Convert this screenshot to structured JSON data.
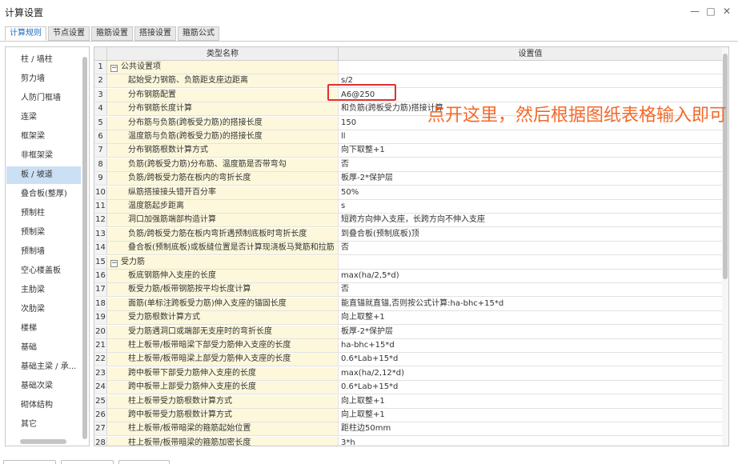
{
  "window": {
    "title": "计算设置",
    "minimize_glyph": "—",
    "maximize_glyph": "□",
    "close_glyph": "✕"
  },
  "tabs": [
    {
      "label": "计算规则",
      "active": true
    },
    {
      "label": "节点设置",
      "active": false
    },
    {
      "label": "箍筋设置",
      "active": false
    },
    {
      "label": "搭接设置",
      "active": false
    },
    {
      "label": "箍筋公式",
      "active": false
    }
  ],
  "sidebar": {
    "items": [
      {
        "label": "柱 / 墙柱"
      },
      {
        "label": "剪力墙"
      },
      {
        "label": "人防门框墙"
      },
      {
        "label": "连梁"
      },
      {
        "label": "框架梁"
      },
      {
        "label": "非框架梁"
      },
      {
        "label": "板 / 坡道",
        "selected": true
      },
      {
        "label": "叠合板(整厚)"
      },
      {
        "label": "预制柱"
      },
      {
        "label": "预制梁"
      },
      {
        "label": "预制墙"
      },
      {
        "label": "空心楼盖板"
      },
      {
        "label": "主肋梁"
      },
      {
        "label": "次肋梁"
      },
      {
        "label": "楼梯"
      },
      {
        "label": "基础"
      },
      {
        "label": "基础主梁 / 承..."
      },
      {
        "label": "基础次梁"
      },
      {
        "label": "砌体结构"
      },
      {
        "label": "其它"
      }
    ]
  },
  "grid": {
    "header_name": "类型名称",
    "header_value": "设置值",
    "rows": [
      {
        "num": "1",
        "name": "公共设置项",
        "value": "",
        "group": true,
        "toggle": "−"
      },
      {
        "num": "2",
        "name": "起始受力钢筋、负筋距支座边距离",
        "value": "s/2"
      },
      {
        "num": "3",
        "name": "分布钢筋配置",
        "value": "A6@250"
      },
      {
        "num": "4",
        "name": "分布钢筋长度计算",
        "value": "和负筋(跨板受力筋)搭接计算"
      },
      {
        "num": "5",
        "name": "分布筋与负筋(跨板受力筋)的搭接长度",
        "value": "150"
      },
      {
        "num": "6",
        "name": "温度筋与负筋(跨板受力筋)的搭接长度",
        "value": "ll"
      },
      {
        "num": "7",
        "name": "分布钢筋根数计算方式",
        "value": "向下取整+1"
      },
      {
        "num": "8",
        "name": "负筋(跨板受力筋)分布筋、温度筋是否带弯勾",
        "value": "否"
      },
      {
        "num": "9",
        "name": "负筋/跨板受力筋在板内的弯折长度",
        "value": "板厚-2*保护层"
      },
      {
        "num": "10",
        "name": "纵筋搭接接头错开百分率",
        "value": "50%"
      },
      {
        "num": "11",
        "name": "温度筋起步距离",
        "value": "s"
      },
      {
        "num": "12",
        "name": "洞口加强筋端部构造计算",
        "value": "短跨方向伸入支座，长跨方向不伸入支座"
      },
      {
        "num": "13",
        "name": "负筋/跨板受力筋在板内弯折遇预制底板时弯折长度",
        "value": "到叠合板(预制底板)顶"
      },
      {
        "num": "14",
        "name": "叠合板(预制底板)或板缝位置是否计算现浇板马凳筋和拉筋",
        "value": "否"
      },
      {
        "num": "15",
        "name": "受力筋",
        "value": "",
        "group": true,
        "toggle": "−"
      },
      {
        "num": "16",
        "name": "板底钢筋伸入支座的长度",
        "value": "max(ha/2,5*d)"
      },
      {
        "num": "17",
        "name": "板受力筋/板带钢筋按平均长度计算",
        "value": "否"
      },
      {
        "num": "18",
        "name": "面筋(单标注跨板受力筋)伸入支座的锚固长度",
        "value": "能直锚就直锚,否则按公式计算:ha-bhc+15*d"
      },
      {
        "num": "19",
        "name": "受力筋根数计算方式",
        "value": "向上取整+1"
      },
      {
        "num": "20",
        "name": "受力筋遇洞口或端部无支座时的弯折长度",
        "value": "板厚-2*保护层"
      },
      {
        "num": "21",
        "name": "柱上板带/板带暗梁下部受力筋伸入支座的长度",
        "value": "ha-bhc+15*d"
      },
      {
        "num": "22",
        "name": "柱上板带/板带暗梁上部受力筋伸入支座的长度",
        "value": "0.6*Lab+15*d"
      },
      {
        "num": "23",
        "name": "跨中板带下部受力筋伸入支座的长度",
        "value": "max(ha/2,12*d)"
      },
      {
        "num": "24",
        "name": "跨中板带上部受力筋伸入支座的长度",
        "value": "0.6*Lab+15*d"
      },
      {
        "num": "25",
        "name": "柱上板带受力筋根数计算方式",
        "value": "向上取整+1"
      },
      {
        "num": "26",
        "name": "跨中板带受力筋根数计算方式",
        "value": "向上取整+1"
      },
      {
        "num": "27",
        "name": "柱上板带/板带暗梁的箍筋起始位置",
        "value": "距柱边50mm"
      },
      {
        "num": "28",
        "name": "柱上板带/板带暗梁的箍筋加密长度",
        "value": "3*h"
      }
    ]
  },
  "annotation": {
    "text": "点开这里，然后根据图纸表格输入即可",
    "color": "#f2692a",
    "box_color": "#e03030"
  },
  "colors": {
    "name_column_bg": "#fdf8dc",
    "selected_item_bg": "#cce0f5",
    "active_tab_text": "#1f6fbf"
  }
}
